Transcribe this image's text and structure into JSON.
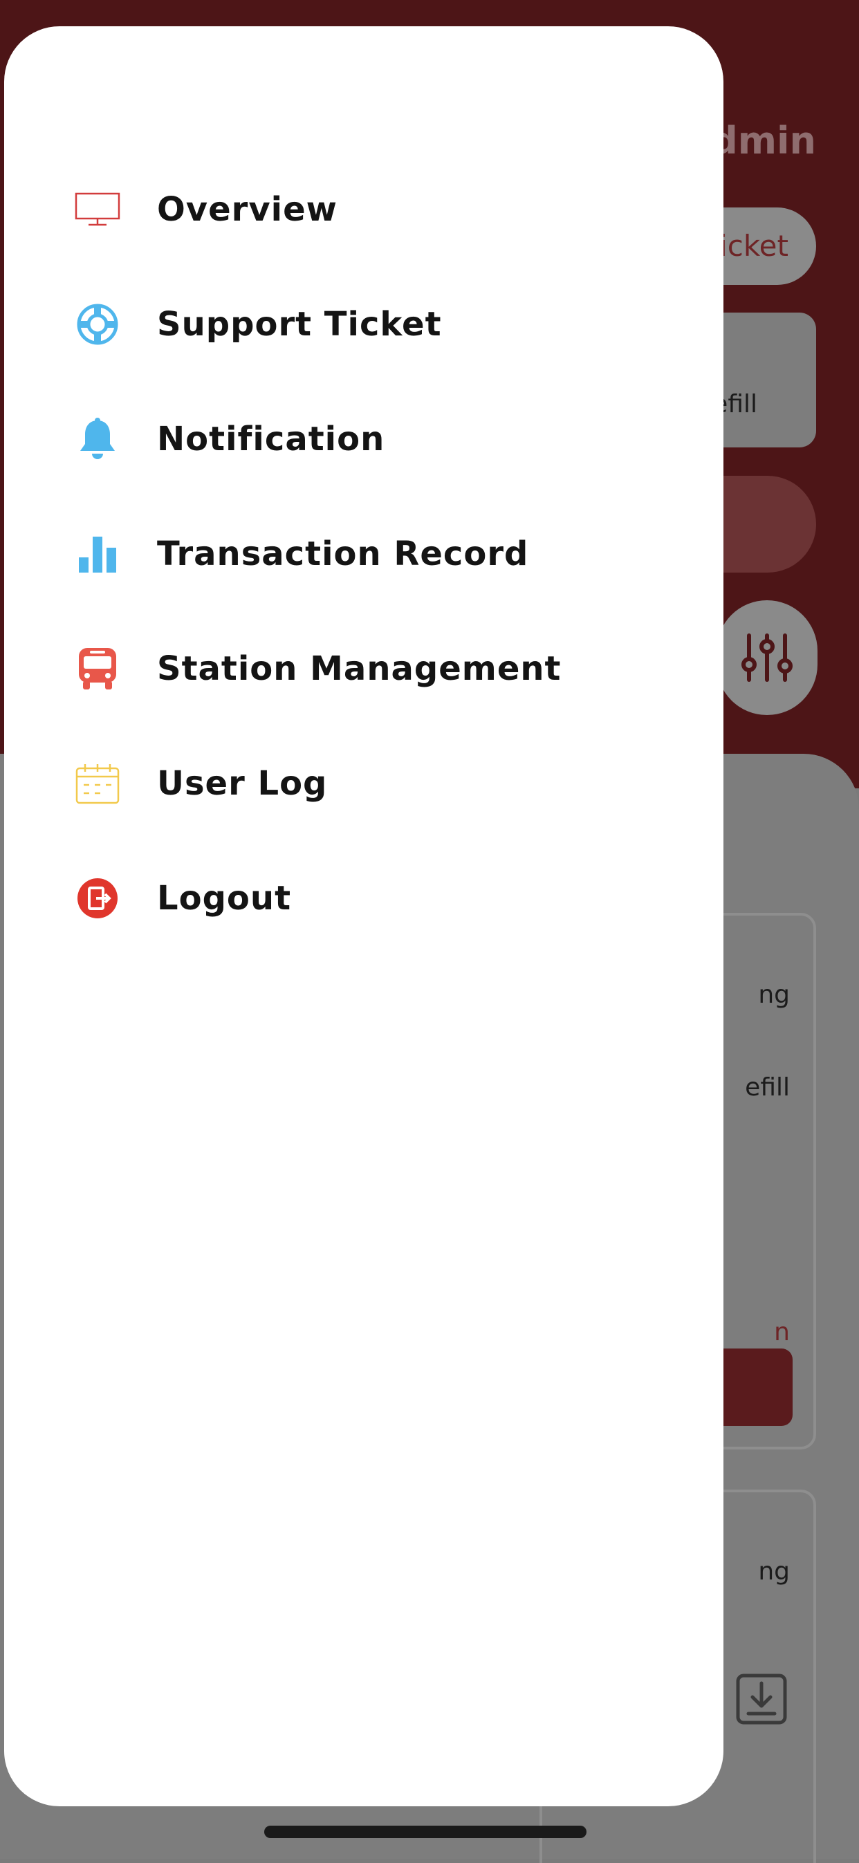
{
  "background": {
    "title": "dmin",
    "pill_text": "icket",
    "card_text": "efill",
    "panel_texts": [
      "ng",
      "efill",
      "n",
      "ng"
    ]
  },
  "drawer": {
    "items": [
      {
        "label": "Overview",
        "icon": "monitor-icon",
        "color": "#d23c3c"
      },
      {
        "label": "Support Ticket",
        "icon": "lifebuoy-icon",
        "color": "#4fb6ec"
      },
      {
        "label": "Notification",
        "icon": "bell-icon",
        "color": "#4fb6ec"
      },
      {
        "label": "Transaction Record",
        "icon": "bar-chart-icon",
        "color": "#4fb6ec"
      },
      {
        "label": "Station Management",
        "icon": "bus-icon",
        "color": "#e8574a"
      },
      {
        "label": "User Log",
        "icon": "calendar-icon",
        "color": "#f2c94c"
      },
      {
        "label": "Logout",
        "icon": "logout-icon",
        "color": "#e0362c"
      }
    ]
  }
}
